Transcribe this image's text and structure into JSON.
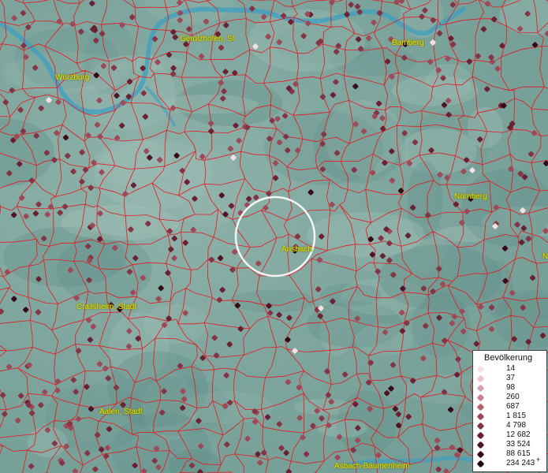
{
  "map": {
    "cities": {
      "wuerzburg": "Würzburg",
      "gerolzhofen": "Gerolzhofen, St",
      "bamberg": "Bamberg",
      "nuernberg": "Nürnberg",
      "ansbach": "Ansbach",
      "crailsheim": "Crailsheim, Stadt",
      "aalen": "Aalen, Stadt",
      "asbach": "Asbach-Bäumenheim",
      "edge": "N"
    },
    "colors": {
      "border": "#e8161c",
      "river": "#3f9fc0",
      "label": "#e8e800"
    }
  },
  "legend": {
    "title": "Bevölkerung",
    "entries": [
      {
        "label": "14",
        "color": "#f7dfe6"
      },
      {
        "label": "37",
        "color": "#ebc3cc"
      },
      {
        "label": "98",
        "color": "#d9a2ad"
      },
      {
        "label": "260",
        "color": "#c7818e"
      },
      {
        "label": "687",
        "color": "#b36470"
      },
      {
        "label": "1 815",
        "color": "#9c4a57"
      },
      {
        "label": "4 798",
        "color": "#843545"
      },
      {
        "label": "12 682",
        "color": "#6a2233"
      },
      {
        "label": "33 524",
        "color": "#501424"
      },
      {
        "label": "88 615",
        "color": "#360a17"
      },
      {
        "label": "234 243",
        "color": "#1d030b"
      }
    ],
    "plus": "+"
  }
}
